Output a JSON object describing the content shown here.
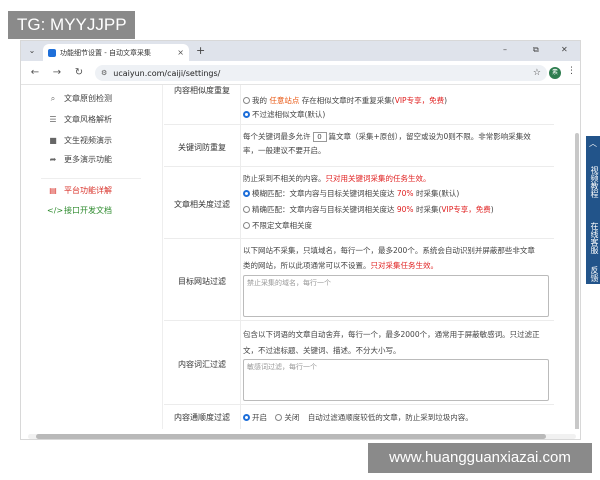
{
  "watermark_top": "TG: MYYJJPP",
  "watermark_bottom": "www.huangguanxiazai.com",
  "browser": {
    "tab_title": "功能细节设置 - 自动文章采集",
    "tab_close": "×",
    "new_tab": "+",
    "url": "ucaiyun.com/caiji/settings/",
    "profile_initial": "素",
    "window_controls": [
      "–",
      "⧉",
      "✕"
    ]
  },
  "sidebar": {
    "items": [
      {
        "icon": "search-icon",
        "glyph": "⌕",
        "label": "文章原创检测"
      },
      {
        "icon": "list-icon",
        "glyph": "☰",
        "label": "文章风格解析"
      },
      {
        "icon": "video-icon",
        "glyph": "■",
        "label": "文生视频演示"
      },
      {
        "icon": "share-icon",
        "glyph": "➦",
        "label": "更多演示功能"
      },
      {
        "icon": "doc-icon",
        "glyph": "▤",
        "label": "平台功能详解"
      },
      {
        "icon": "code-icon",
        "glyph": "</>",
        "label": "接口开发文档"
      }
    ]
  },
  "settings": {
    "dedupe": {
      "label": "内容相似度重复",
      "opt1_prefix": "我的",
      "opt1_highlight": "任意站点",
      "opt1_suffix": "存在相似文章时不重复采集(",
      "opt1_vip": "VIP专享，免费",
      "opt1_close": ")",
      "opt2": "不过滤相似文章(默认)"
    },
    "keyword_repeat": {
      "label": "关键词防重复",
      "line1_prefix": "每个关键词最多允许",
      "line1_value": "0",
      "line1_suffix": "篇文章（采集+原创），留空或设为0则不限。非常影响采集效",
      "line2": "率，一般建议不要开启。"
    },
    "relevance": {
      "label": "文章相关度过滤",
      "line1_prefix": "防止采到不相关的内容。",
      "line1_note": "只对用关键词采集的任务生效。",
      "opt1_label": "模糊匹配：文章内容与目标关键词相关度达",
      "opt1_percent": "70%",
      "opt1_suffix": "时采集(默认)",
      "opt2_label": "精确匹配：文章内容与目标关键词相关度达",
      "opt2_percent": "90%",
      "opt2_suffix": "时采集(",
      "opt2_vip": "VIP专享，免费",
      "opt2_close": ")",
      "opt3": "不限定文章相关度"
    },
    "site_filter": {
      "label": "目标网站过滤",
      "line1": "以下网站不采集，只填域名，每行一个，最多200个。系统会自动识别并屏蔽那些非文章",
      "line2_prefix": "类的网站，所以此项通常可以不设置。",
      "line2_note": "只对采集任务生效。",
      "placeholder": "禁止采集的域名，每行一个"
    },
    "word_filter": {
      "label": "内容词汇过滤",
      "line1": "包含以下词语的文章自动舍弃，每行一个，最多2000个，通常用于屏蔽敏感词。只过滤正",
      "line2": "文，不过滤标题、关键词、描述。不分大小写。",
      "placeholder": "敏感词过滤，每行一个"
    },
    "fluency": {
      "label": "内容通顺度过滤",
      "opt_on": "开启",
      "opt_off": "关闭",
      "desc": "自动过滤通顺度较低的文章，防止采到垃圾内容。"
    }
  },
  "float_panel": {
    "top": "︿",
    "tutorial": "视频教程",
    "service": "在线客服",
    "feedback": "反馈"
  },
  "colors": {
    "accent": "#1e6fd9",
    "highlight": "#e8540e",
    "vip": "#e02020",
    "float_panel": "#22548a"
  }
}
